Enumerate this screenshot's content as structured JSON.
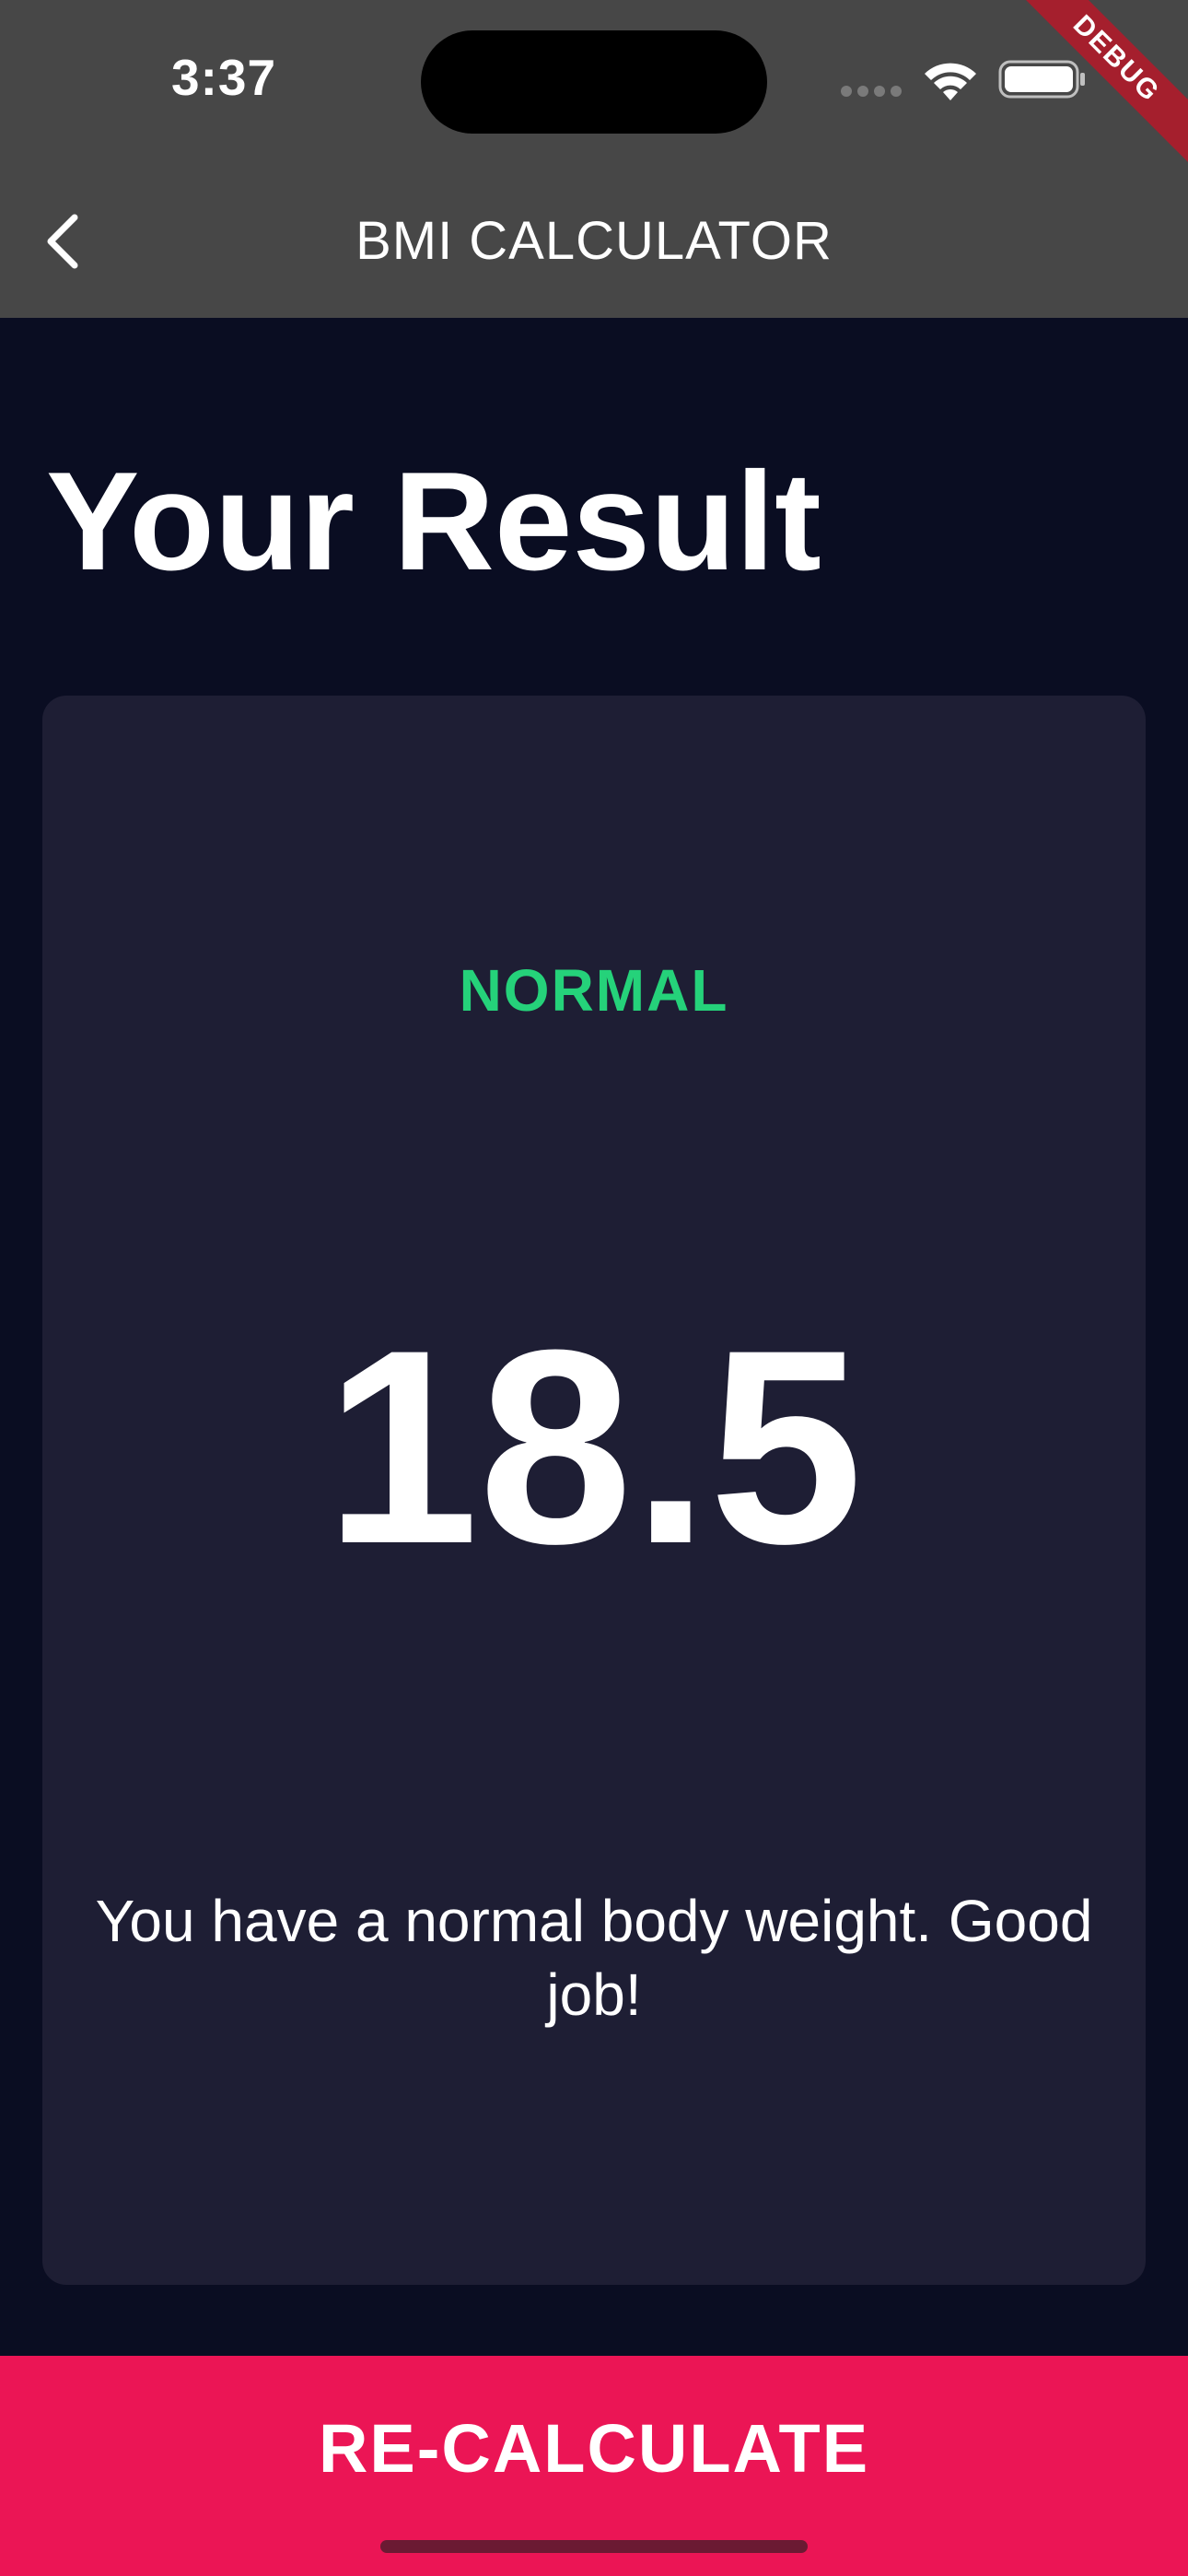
{
  "status_bar": {
    "time": "3:37",
    "debug_label": "DEBUG"
  },
  "app_bar": {
    "title": "BMI CALCULATOR",
    "back_icon": "chevron-left-icon"
  },
  "page": {
    "title": "Your Result"
  },
  "result": {
    "status": "NORMAL",
    "value": "18.5",
    "message": "You have a normal body weight. Good job!"
  },
  "actions": {
    "recalculate_label": "RE-CALCULATE"
  },
  "colors": {
    "background": "#0a0d22",
    "app_bar": "#474747",
    "card": "#1e1e34",
    "status_normal": "#25d27a",
    "accent": "#eb1555"
  },
  "icons": {
    "wifi": "wifi-icon",
    "battery": "battery-icon",
    "signal": "cellular-signal-icon"
  }
}
